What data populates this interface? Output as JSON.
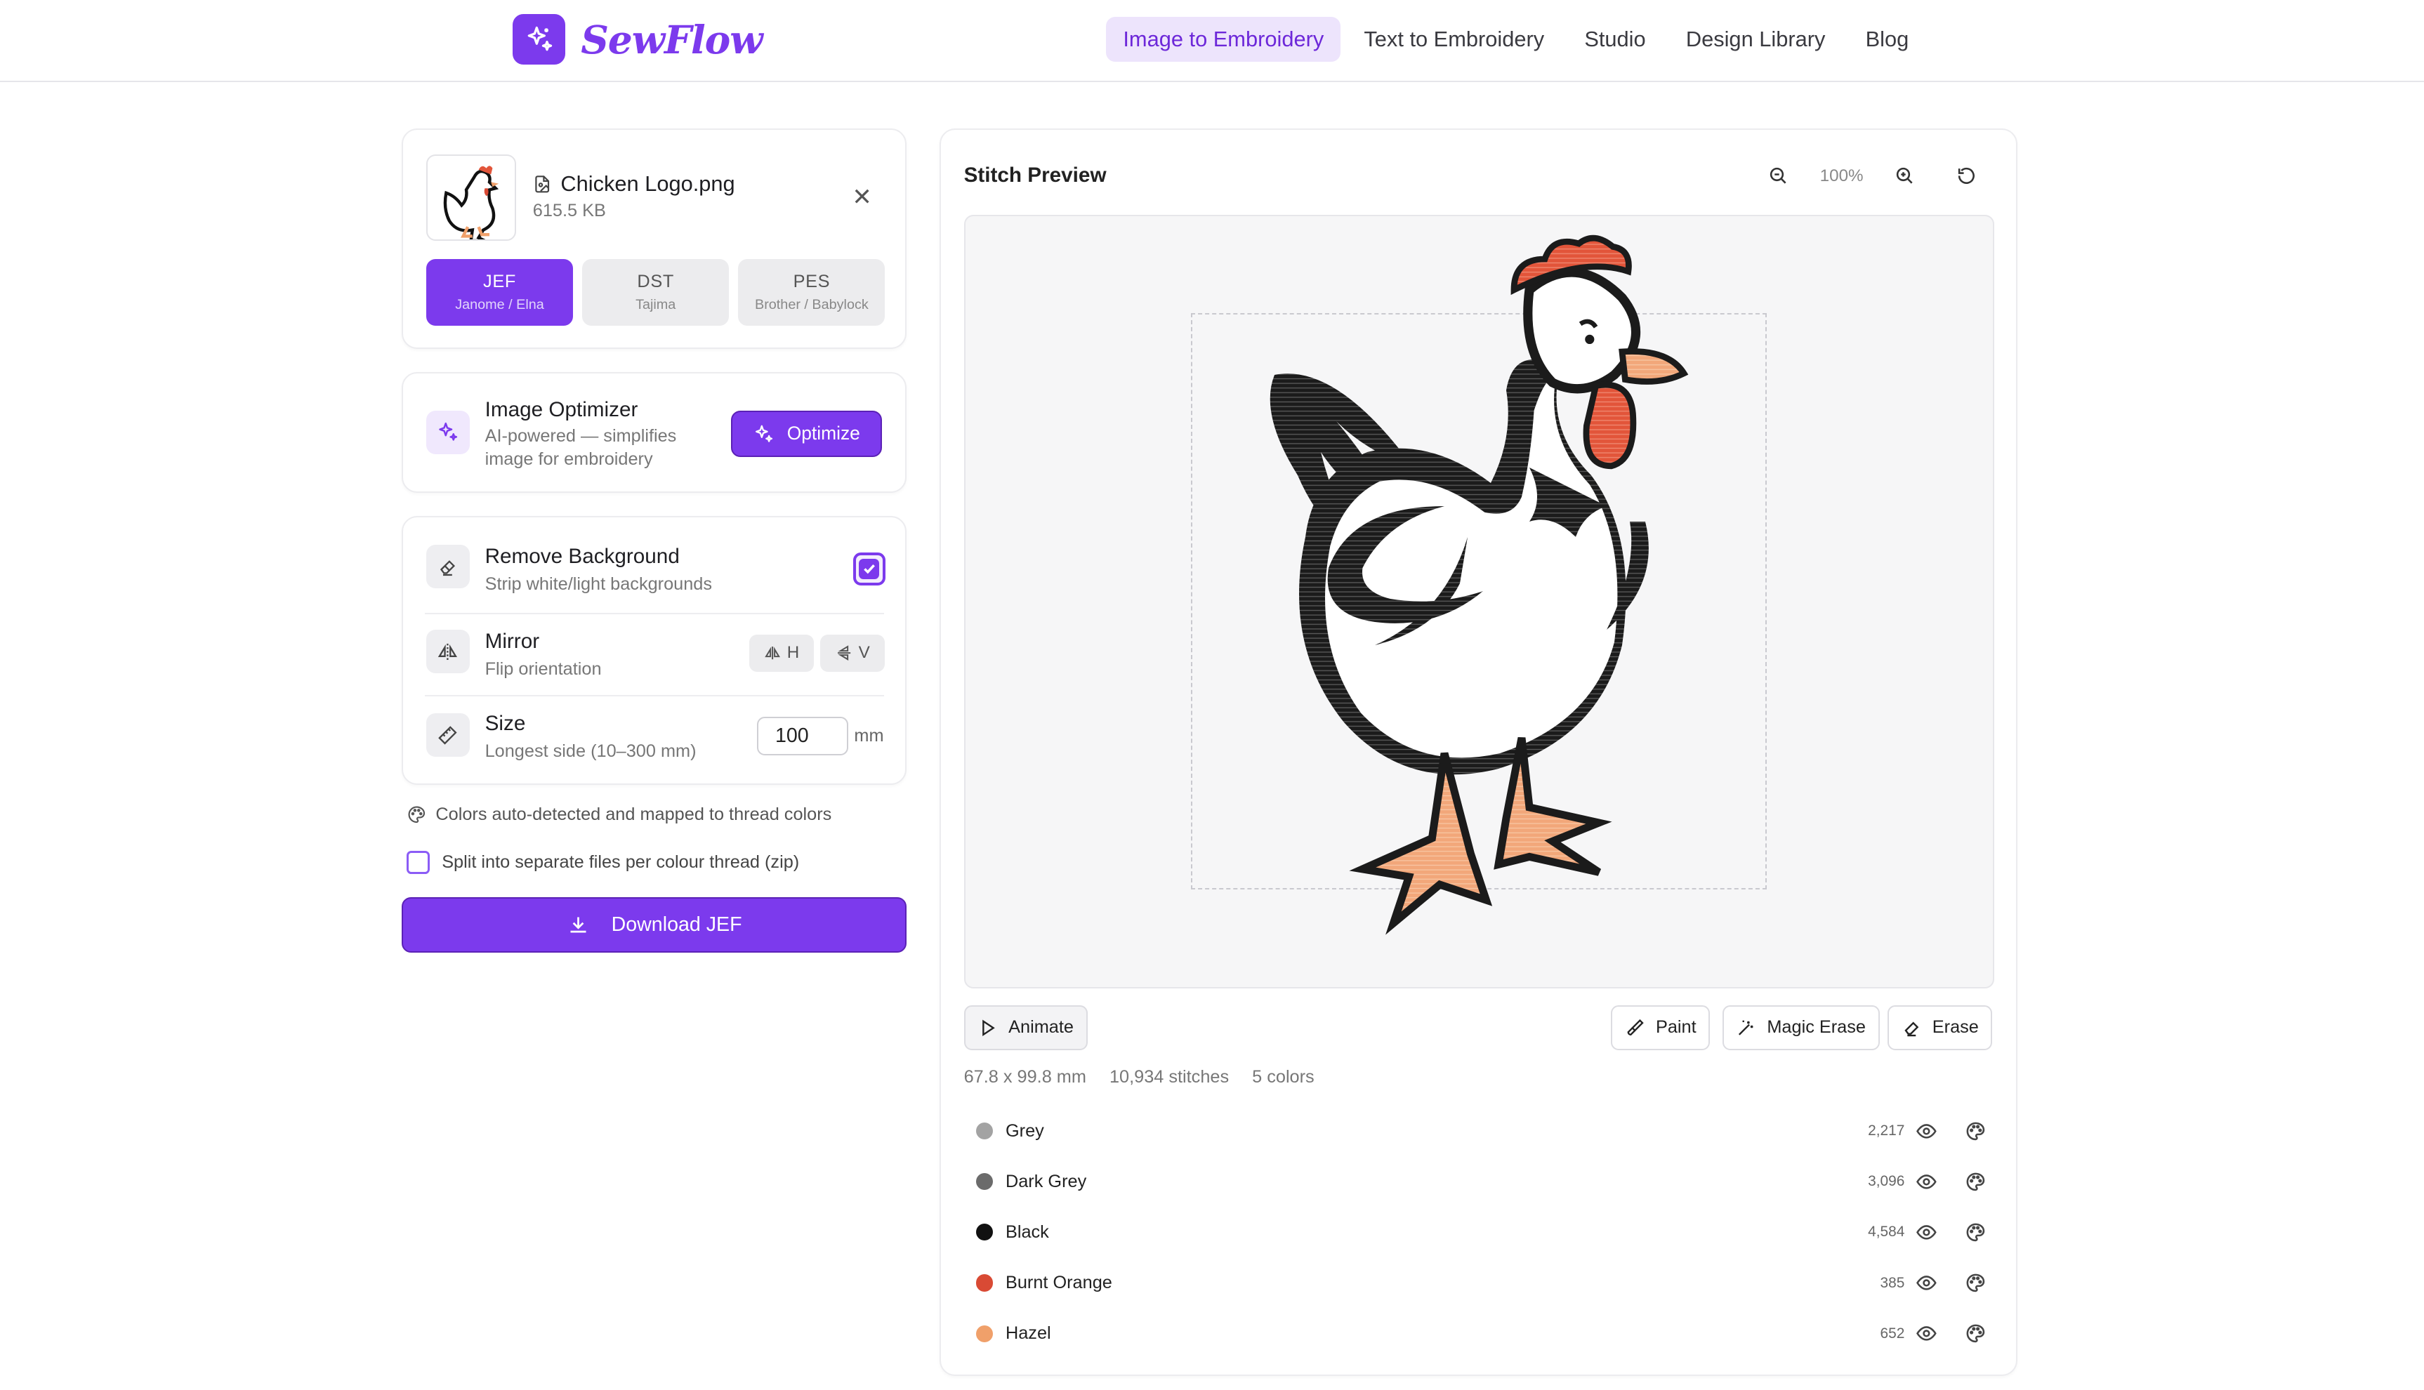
{
  "brand": {
    "name": "SewFlow",
    "accent": "#7c3aed"
  },
  "nav": [
    {
      "label": "Image to Embroidery",
      "active": true
    },
    {
      "label": "Text to Embroidery"
    },
    {
      "label": "Studio"
    },
    {
      "label": "Design Library"
    },
    {
      "label": "Blog"
    }
  ],
  "file": {
    "name": "Chicken Logo.png",
    "size": "615.5 KB"
  },
  "formats": [
    {
      "code": "JEF",
      "machine": "Janome / Elna",
      "active": true
    },
    {
      "code": "DST",
      "machine": "Tajima"
    },
    {
      "code": "PES",
      "machine": "Brother / Babylock"
    }
  ],
  "optimizer": {
    "title": "Image Optimizer",
    "subtitle_1": "AI-powered — simplifies",
    "subtitle_2": "image for embroidery",
    "button": "Optimize"
  },
  "settings": {
    "remove_bg": {
      "title": "Remove Background",
      "subtitle": "Strip white/light backgrounds",
      "checked": true
    },
    "mirror": {
      "title": "Mirror",
      "subtitle": "Flip orientation",
      "h": "H",
      "v": "V"
    },
    "size": {
      "title": "Size",
      "subtitle": "Longest side (10–300 mm)",
      "value": "100",
      "unit": "mm"
    }
  },
  "info": {
    "colors_note": "Colors auto-detected and mapped to thread colors",
    "split_label": "Split into separate files per colour thread (zip)"
  },
  "download": {
    "label": "Download JEF"
  },
  "preview": {
    "title": "Stitch Preview",
    "zoom": "100%",
    "tools": {
      "animate": "Animate",
      "paint": "Paint",
      "magic_erase": "Magic Erase",
      "erase": "Erase"
    },
    "stats": {
      "dimensions": "67.8 x 99.8 mm",
      "stitches": "10,934 stitches",
      "colors": "5 colors"
    }
  },
  "threads": [
    {
      "name": "Grey",
      "count": "2,217",
      "color": "#a3a3a3"
    },
    {
      "name": "Dark Grey",
      "count": "3,096",
      "color": "#6b6b6b"
    },
    {
      "name": "Black",
      "count": "4,584",
      "color": "#111111"
    },
    {
      "name": "Burnt Orange",
      "count": "385",
      "color": "#d94a34"
    },
    {
      "name": "Hazel",
      "count": "652",
      "color": "#f0a06a"
    }
  ]
}
